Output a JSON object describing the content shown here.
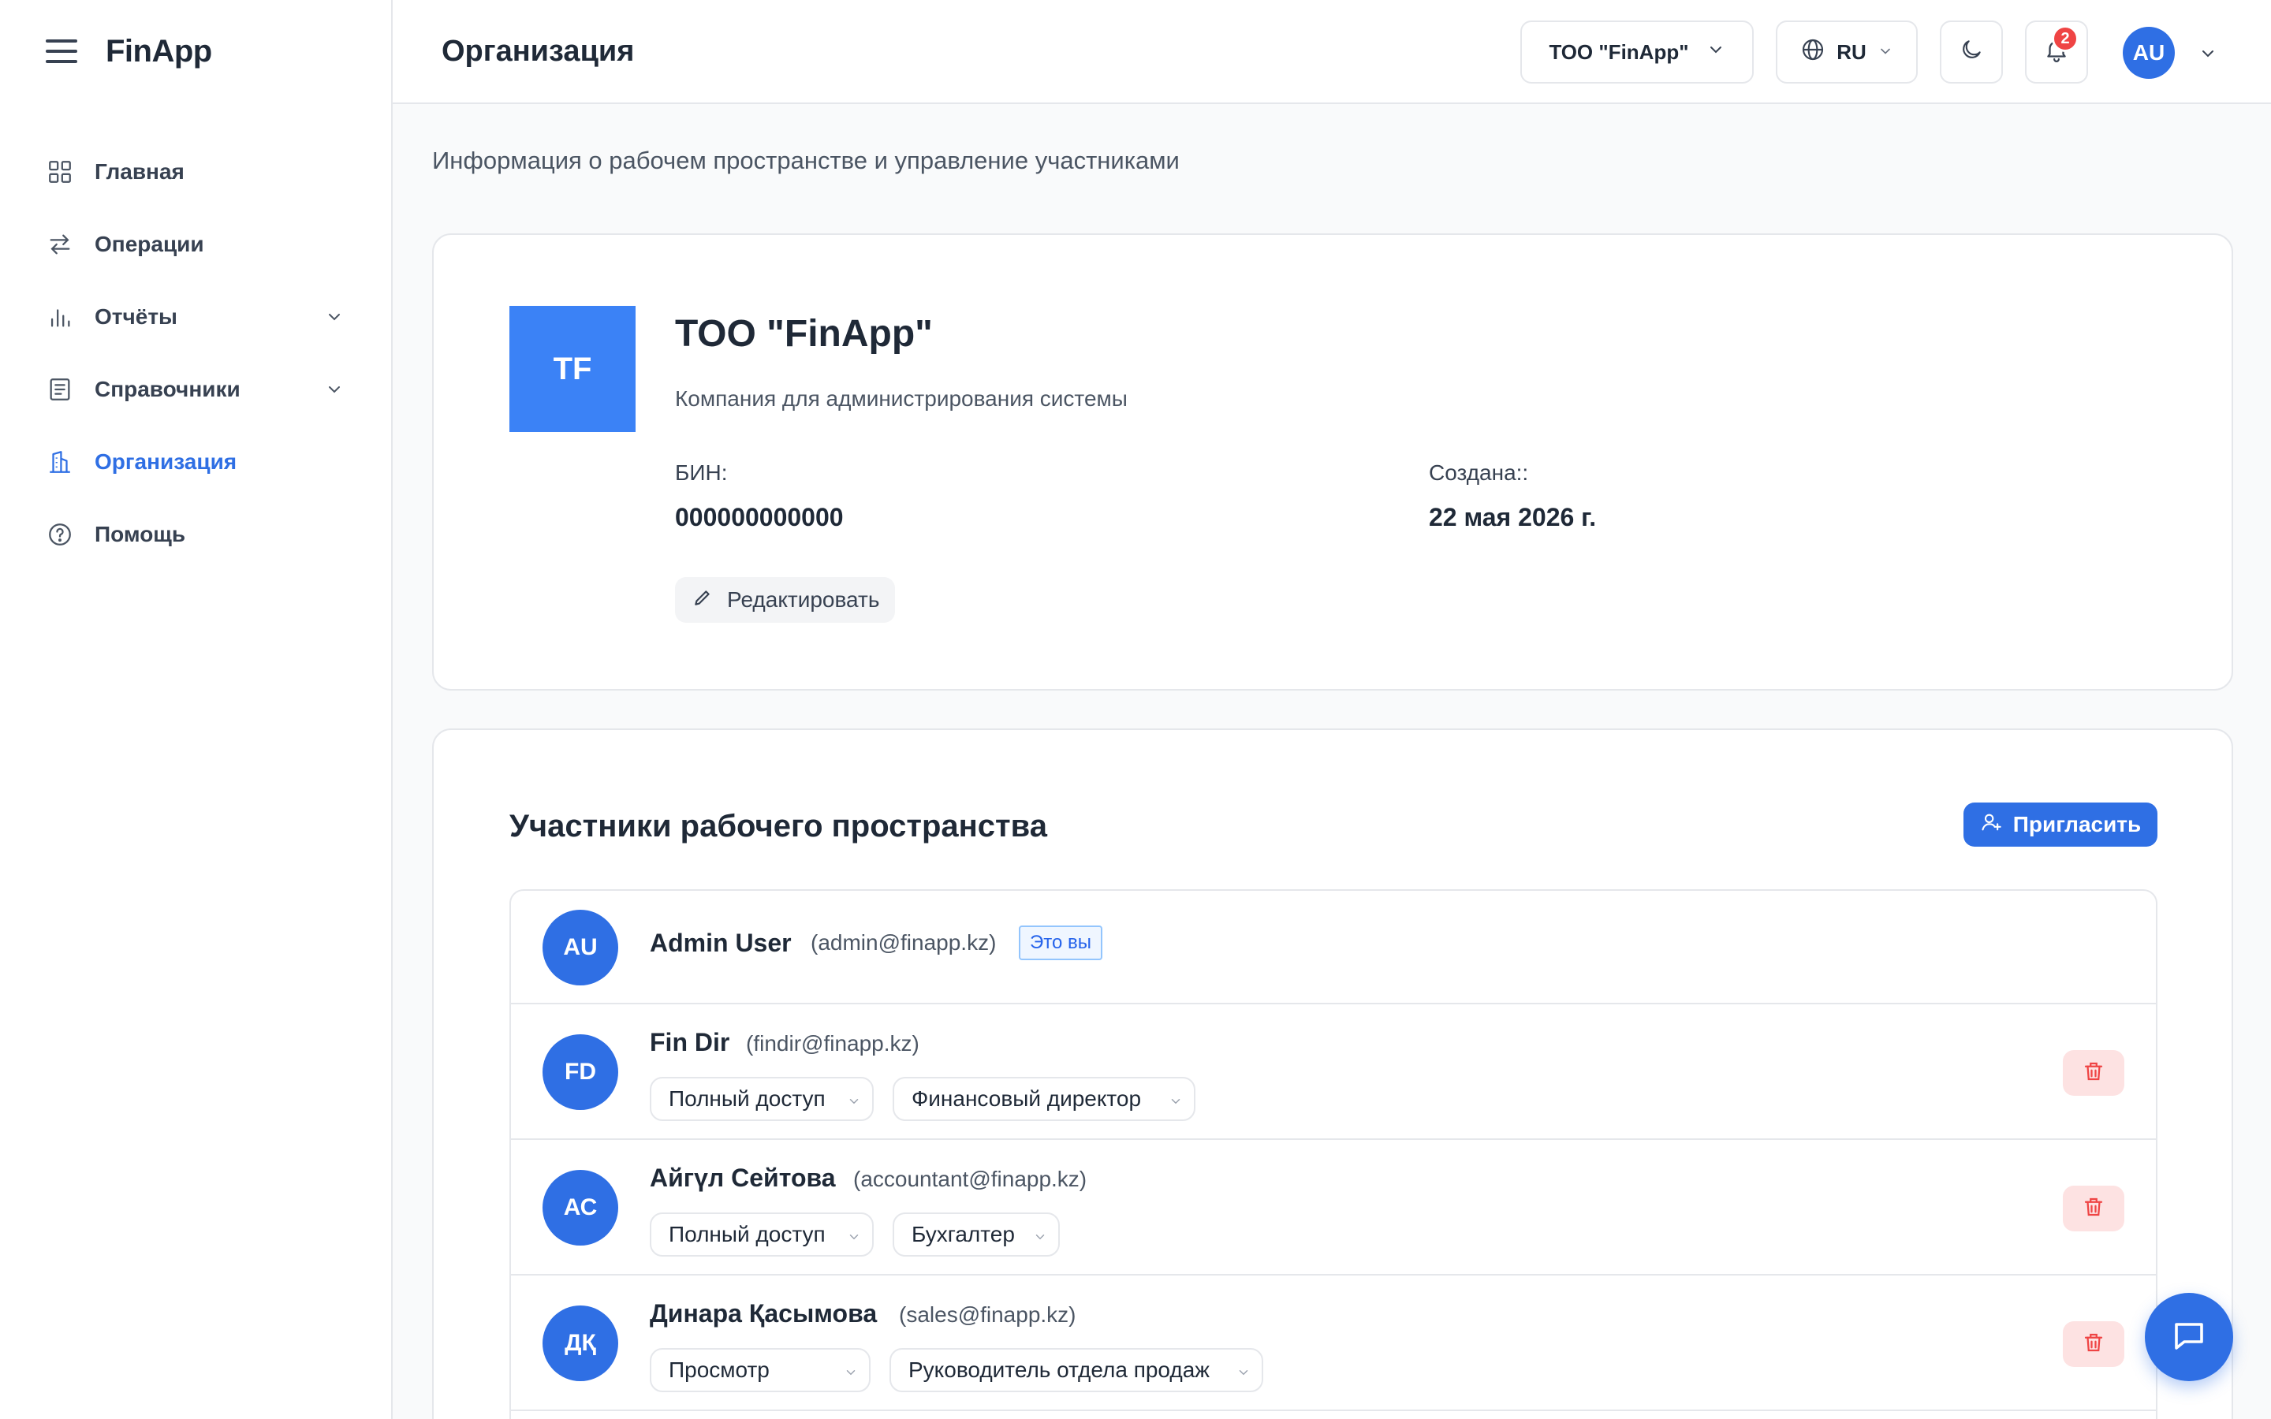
{
  "app": {
    "brand": "FinApp"
  },
  "sidebar": {
    "items": [
      {
        "label": "Главная",
        "icon": "grid-icon"
      },
      {
        "label": "Операции",
        "icon": "arrows-swap-icon"
      },
      {
        "label": "Отчёты",
        "icon": "bar-chart-icon"
      },
      {
        "label": "Справочники",
        "icon": "book-icon"
      },
      {
        "label": "Организация",
        "icon": "building-icon",
        "active": true
      },
      {
        "label": "Помощь",
        "icon": "help-circle-icon"
      }
    ]
  },
  "header": {
    "title": "Организация",
    "org_selector": "ТОО \"FinApp\"",
    "language": "RU",
    "notifications_count": "2",
    "user_initials": "AU"
  },
  "page": {
    "subtitle": "Информация о рабочем пространстве и управление участниками"
  },
  "organization": {
    "logo_initials": "TF",
    "name": "ТОО \"FinApp\"",
    "description": "Компания для администрирования системы",
    "bin_label": "БИН:",
    "bin_value": "000000000000",
    "created_label": "Создана::",
    "created_value": "22 мая 2026 г.",
    "edit_label": "Редактировать"
  },
  "members": {
    "title": "Участники рабочего пространства",
    "invite_label": "Пригласить",
    "you_tag": "Это вы",
    "rows": [
      {
        "initials": "AU",
        "name": "Admin User",
        "email": "(admin@finapp.kz)"
      },
      {
        "initials": "FD",
        "name": "Fin Dir",
        "email": "(findir@finapp.kz)",
        "access": "Полный доступ",
        "role": "Финансовый директор"
      },
      {
        "initials": "АС",
        "name": "Айгүл Сейтова",
        "email": "(accountant@finapp.kz)",
        "access": "Полный доступ",
        "role": "Бухгалтер"
      },
      {
        "initials": "ДҚ",
        "name": "Динара Қасымова",
        "email": "(sales@finapp.kz)",
        "access": "Просмотр",
        "role": "Руководитель отдела продаж"
      }
    ]
  },
  "colors": {
    "accent": "#2f6fe4",
    "danger": "#ef4444",
    "danger_bg": "#fde2e2"
  }
}
